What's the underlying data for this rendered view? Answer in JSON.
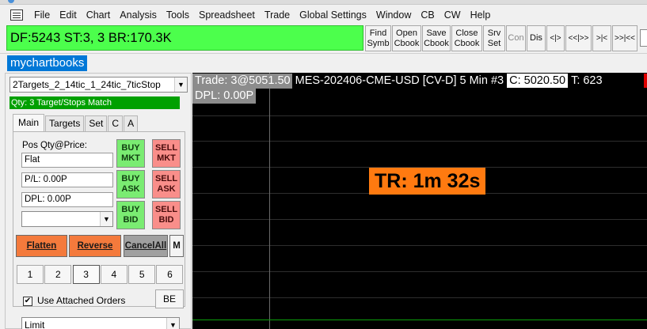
{
  "menu": [
    "File",
    "Edit",
    "Chart",
    "Analysis",
    "Tools",
    "Spreadsheet",
    "Trade",
    "Global Settings",
    "Window",
    "CB",
    "CW",
    "Help"
  ],
  "status_text": "DF:5243  ST:3, 3  BR:170.3K",
  "toolbar_buttons": [
    {
      "label": "Find\nSymb"
    },
    {
      "label": "Open\nCbook"
    },
    {
      "label": "Save\nCbook"
    },
    {
      "label": "Close\nCbook"
    },
    {
      "label": "Srv\nSet"
    },
    {
      "label": "Con"
    },
    {
      "label": "Dis"
    },
    {
      "label": "<|>"
    },
    {
      "label": "<<|>>"
    },
    {
      "label": ">|<"
    },
    {
      "label": ">>|<<"
    }
  ],
  "chartbook_tab": "mychartbooks",
  "trade_window": {
    "strategy": "2Targets_2_14tic_1_24tic_7ticStop",
    "qty_match": "Qty: 3 Target/Stops Match",
    "tabs": [
      "Main",
      "Targets",
      "Set",
      "C",
      "A"
    ],
    "pos_label": "Pos Qty@Price:",
    "pos_value": "Flat",
    "pl_value": "P/L: 0.00P",
    "dpl_value": "DPL: 0.00P",
    "buy_mkt": "BUY\nMKT",
    "sell_mkt": "SELL\nMKT",
    "buy_ask": "BUY\nASK",
    "sell_ask": "SELL\nASK",
    "buy_bid": "BUY\nBID",
    "sell_bid": "SELL\nBID",
    "flatten": "Flatten",
    "reverse": "Reverse",
    "cancel_all": "CancelAll",
    "m_button": "M",
    "quantities": [
      "1",
      "2",
      "3",
      "4",
      "5",
      "6"
    ],
    "selected_quantity": "3",
    "use_attached_orders": "Use Attached Orders",
    "check_mark": "✔",
    "be_button": "BE",
    "order_type": "Limit"
  },
  "chart": {
    "trade_info": "Trade: 3@5051.50",
    "symbol_info": "MES-202406-CME-USD [CV-D]  5 Min  #3",
    "close_info": "C: 5020.50",
    "t_info": "T: 623",
    "dpl": "DPL: 0.00P",
    "timer": "TR: 1m 32s"
  },
  "colors": {
    "status_green": "#4cff4c",
    "chartbook_blue": "#0078d7",
    "buy_green": "#7aec72",
    "sell_red": "#f98e8a",
    "action_orange": "#f47a3c",
    "timer_orange": "#ff7a10"
  }
}
